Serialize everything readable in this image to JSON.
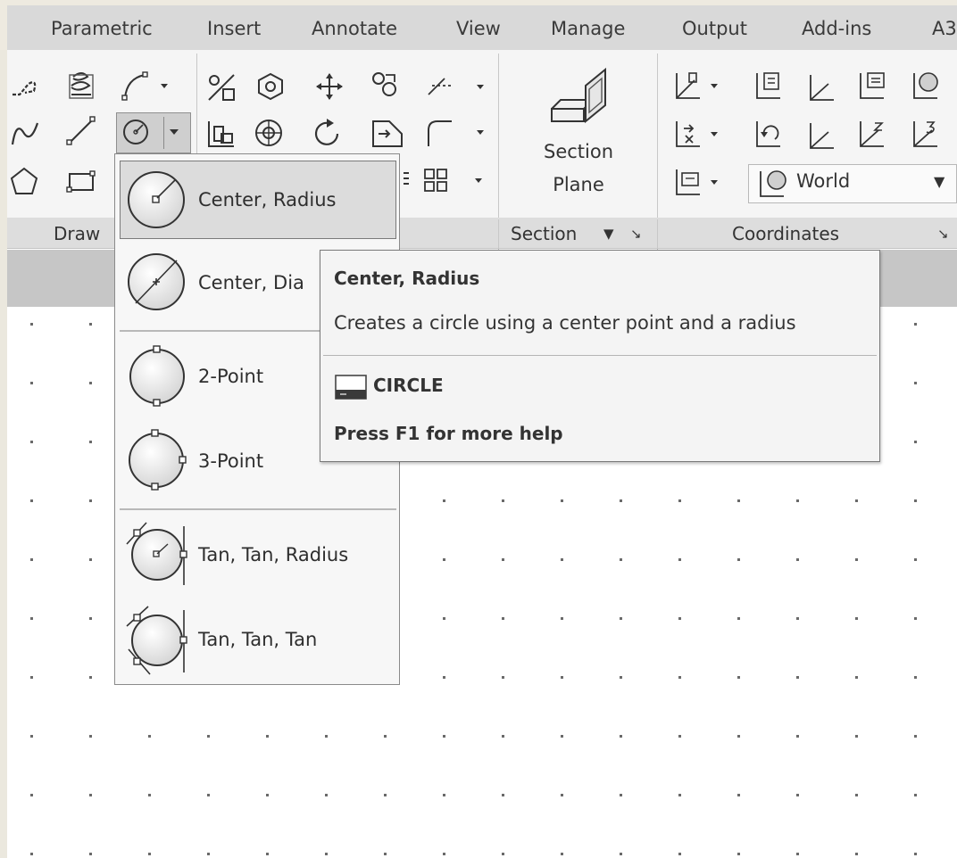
{
  "ribbon": {
    "tabs": [
      "Parametric",
      "Insert",
      "Annotate",
      "View",
      "Manage",
      "Output",
      "Add-ins",
      "A3"
    ],
    "panels": {
      "draw": "Draw",
      "section": "Section",
      "section_arrow": "▼",
      "section_launcher": "↘",
      "coordinates": "Coordinates",
      "coordinates_launcher": "↘"
    },
    "section_plane": {
      "line1": "Section",
      "line2": "Plane"
    },
    "ucs_combo": {
      "value": "World",
      "arrow": "▼"
    }
  },
  "circle_menu": {
    "items": [
      {
        "label": "Center, Radius",
        "icon": "circle-center-radius-icon"
      },
      {
        "label": "Center, Dia",
        "icon": "circle-center-diameter-icon"
      },
      {
        "label": "2-Point",
        "icon": "circle-2point-icon"
      },
      {
        "label": "3-Point",
        "icon": "circle-3point-icon"
      },
      {
        "label": "Tan, Tan, Radius",
        "icon": "circle-ttr-icon"
      },
      {
        "label": "Tan, Tan, Tan",
        "icon": "circle-ttt-icon"
      }
    ]
  },
  "tooltip": {
    "title": "Center, Radius",
    "description": "Creates a circle using a center point and a radius",
    "command": "CIRCLE",
    "help": "Press F1 for more help"
  },
  "colors": {
    "tab_bar": "#d9d9d9",
    "ribbon": "#f5f5f5",
    "panel_bar": "#dddddd",
    "file_bar": "#c6c6c6",
    "highlight": "#dcdcdc"
  }
}
